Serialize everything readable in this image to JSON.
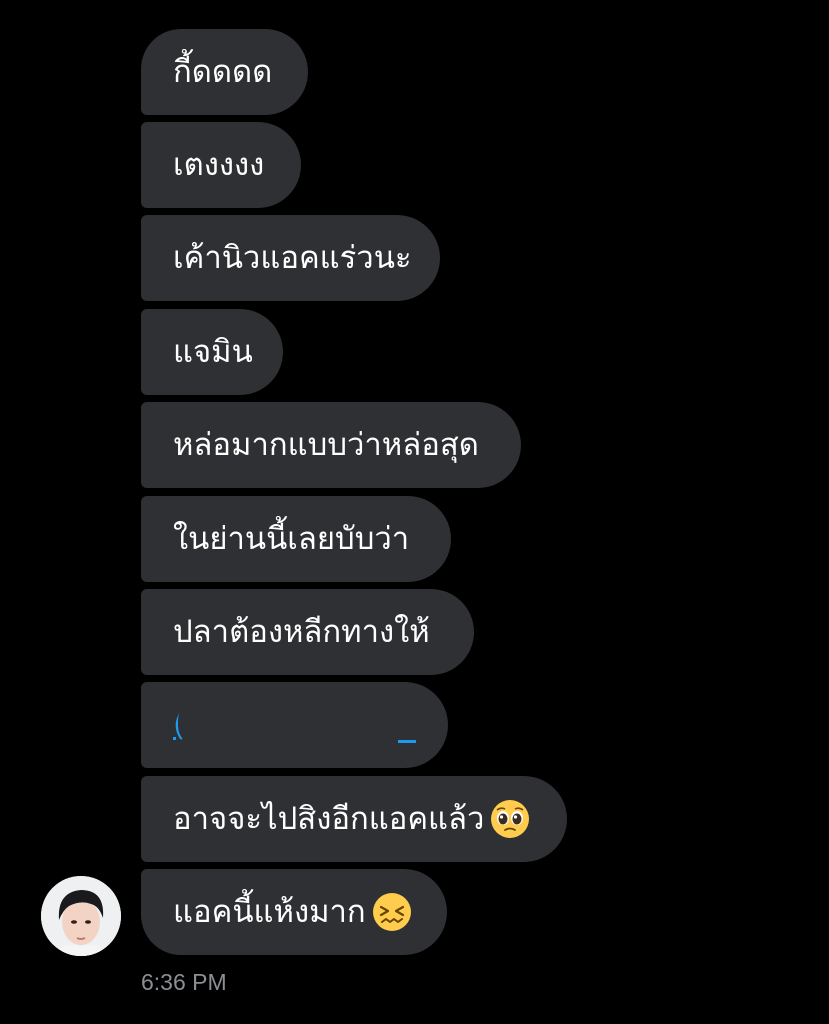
{
  "chat": {
    "messages": [
      {
        "text": "กี้ดดดด"
      },
      {
        "text": "เตงงงง"
      },
      {
        "text": "เค้านิวแอคแร่วนะ"
      },
      {
        "text": "แจมิน"
      },
      {
        "text": "หล่อมากแบบว่าหล่อสุด"
      },
      {
        "text": "ในย่านนี้เลยบับว่า"
      },
      {
        "text": "ปลาต้องหลีกทางให้"
      },
      {
        "text": "(",
        "kind": "link-redacted"
      },
      {
        "text": "อาจจะไปสิงอีกแอคแล้ว",
        "emoji": "pleading-face-emoji"
      },
      {
        "text": "แอคนี้แห้งมาก",
        "emoji": "confounded-face-emoji"
      }
    ],
    "timestamp": "6:36 PM"
  },
  "colors": {
    "background": "#000000",
    "bubble": "#2f3033",
    "text": "#ffffff",
    "link": "#1d9bf0",
    "timestamp": "#8b8f94"
  },
  "avatar": {
    "icon": "profile-photo-avatar"
  }
}
